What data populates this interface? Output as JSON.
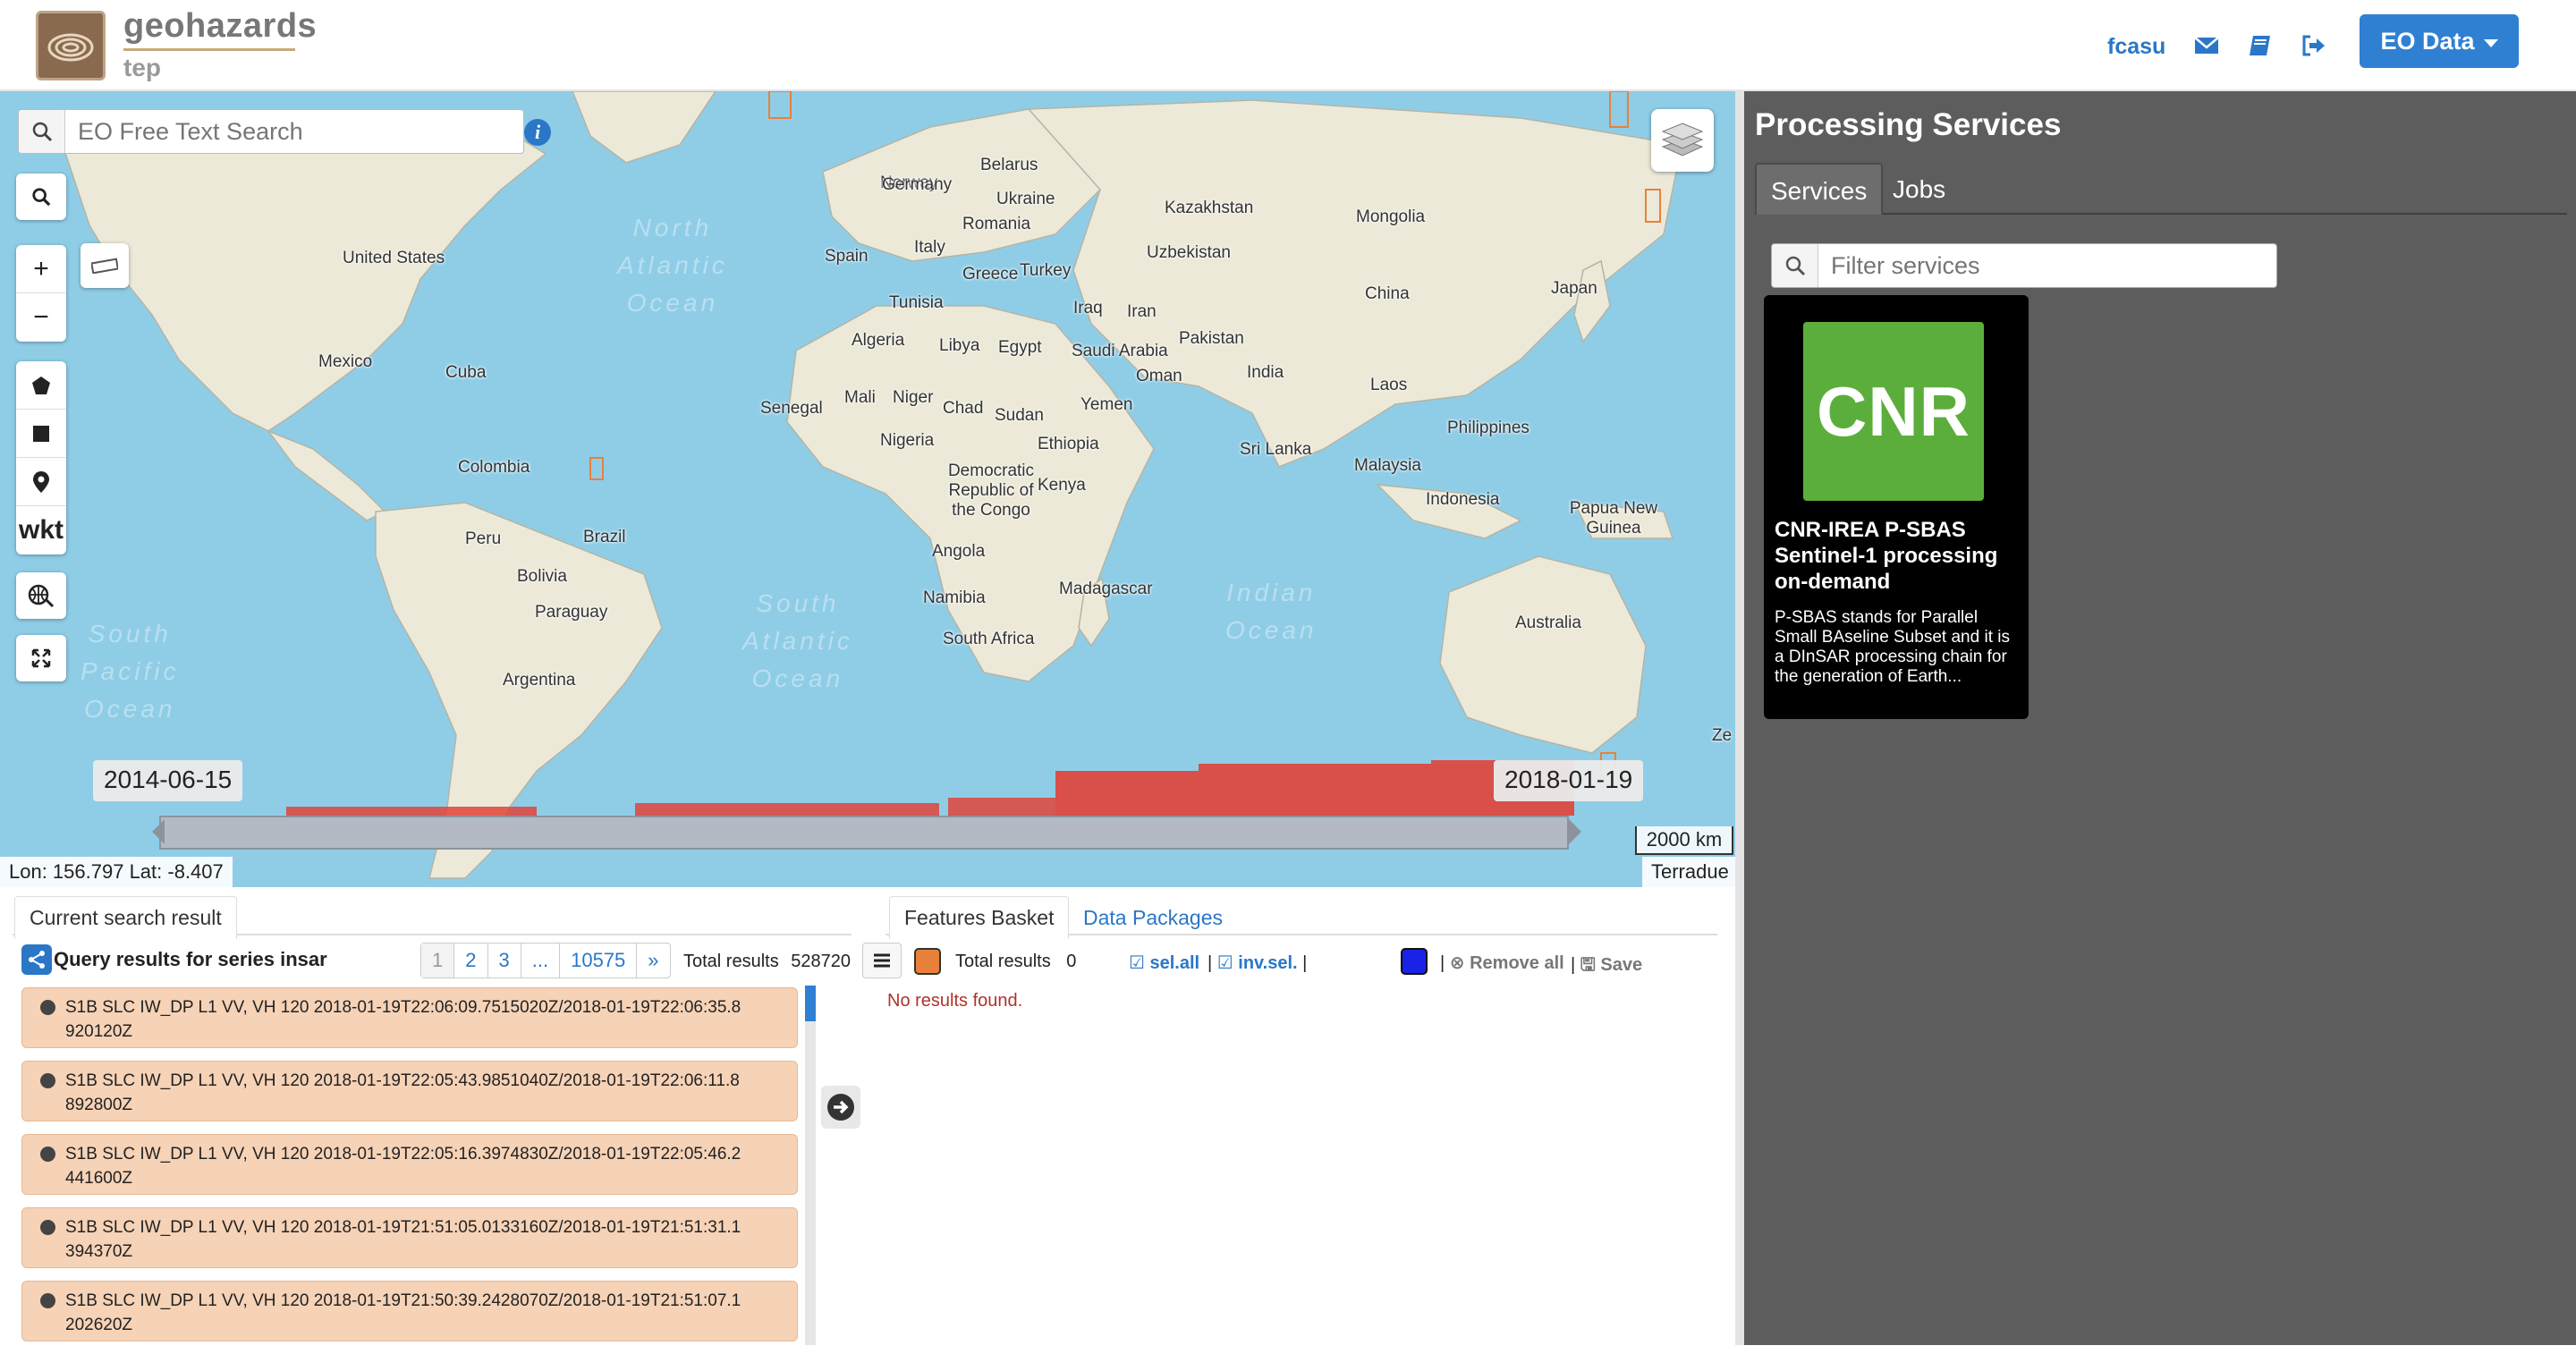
{
  "header": {
    "brand_title": "geohazards",
    "brand_sub": "tep",
    "username": "fcasu",
    "eo_button": "EO Data",
    "icons": [
      "envelope-icon",
      "book-icon",
      "signout-icon"
    ]
  },
  "map": {
    "search_placeholder": "EO Free Text Search",
    "tools": {
      "wkt": "wkt"
    },
    "date_start": "2014-06-15",
    "date_end": "2018-01-19",
    "scale": "2000 km",
    "coords": "Lon: 156.797 Lat: -8.407",
    "attribution": "Terradue",
    "oceans": [
      {
        "text": "North Atlantic Ocean"
      },
      {
        "text": "South Atlantic Ocean"
      },
      {
        "text": "Indian Ocean"
      },
      {
        "text": "South Pacific Ocean"
      }
    ],
    "labels": [
      "United States",
      "Mexico",
      "Cuba",
      "Colombia",
      "Peru",
      "Brazil",
      "Bolivia",
      "Paraguay",
      "Argentina",
      "Norway",
      "Germany",
      "Belarus",
      "Ukraine",
      "Romania",
      "Spain",
      "Italy",
      "Greece",
      "Turkey",
      "Kazakhstan",
      "Uzbekistan",
      "Mongolia",
      "China",
      "Japan",
      "Tunisia",
      "Algeria",
      "Libya",
      "Egypt",
      "Iraq",
      "Iran",
      "Saudi Arabia",
      "Oman",
      "Yemen",
      "Pakistan",
      "India",
      "Laos",
      "Philippines",
      "Sri Lanka",
      "Malaysia",
      "Indonesia",
      "Papua New Guinea",
      "Australia",
      "Senegal",
      "Mali",
      "Niger",
      "Chad",
      "Sudan",
      "Nigeria",
      "Ethiopia",
      "Democratic Republic of the Congo",
      "Kenya",
      "Angola",
      "Namibia",
      "Madagascar",
      "South Africa",
      "Ze"
    ]
  },
  "results": {
    "tab_label": "Current search result",
    "query_title": "Query results for series insar",
    "pages": [
      "1",
      "2",
      "3",
      "...",
      "10575",
      "»"
    ],
    "total_label": "Total results",
    "total_value": "528720",
    "rows": [
      "S1B SLC IW_DP L1 VV, VH 120 2018-01-19T22:06:09.7515020Z/2018-01-19T22:06:35.8 920120Z",
      "S1B SLC IW_DP L1 VV, VH 120 2018-01-19T22:05:43.9851040Z/2018-01-19T22:06:11.8 892800Z",
      "S1B SLC IW_DP L1 VV, VH 120 2018-01-19T22:05:16.3974830Z/2018-01-19T22:05:46.2 441600Z",
      "S1B SLC IW_DP L1 VV, VH 120 2018-01-19T21:51:05.0133160Z/2018-01-19T21:51:31.1 394370Z",
      "S1B SLC IW_DP L1 VV, VH 120 2018-01-19T21:50:39.2428070Z/2018-01-19T21:51:07.1 202620Z"
    ]
  },
  "basket": {
    "tab_features": "Features Basket",
    "tab_packages": "Data Packages",
    "total_label": "Total results",
    "total_value": "0",
    "sel_all": "sel.all",
    "inv_sel": "inv.sel.",
    "remove_all": "Remove all",
    "save": "Save",
    "no_results": "No results found.",
    "color_orange": "#e8813a",
    "color_blue": "#1a22e6"
  },
  "processing": {
    "title": "Processing Services",
    "tabs": [
      "Services",
      "Jobs"
    ],
    "filter_placeholder": "Filter services",
    "service": {
      "logo_text": "CNR",
      "logo_color": "#5bae3c",
      "title": "CNR-IREA P-SBAS Sentinel-1 processing on-demand",
      "description": "P-SBAS stands for Parallel Small BAseline Subset and it is a DInSAR processing chain for the generation of Earth..."
    }
  }
}
